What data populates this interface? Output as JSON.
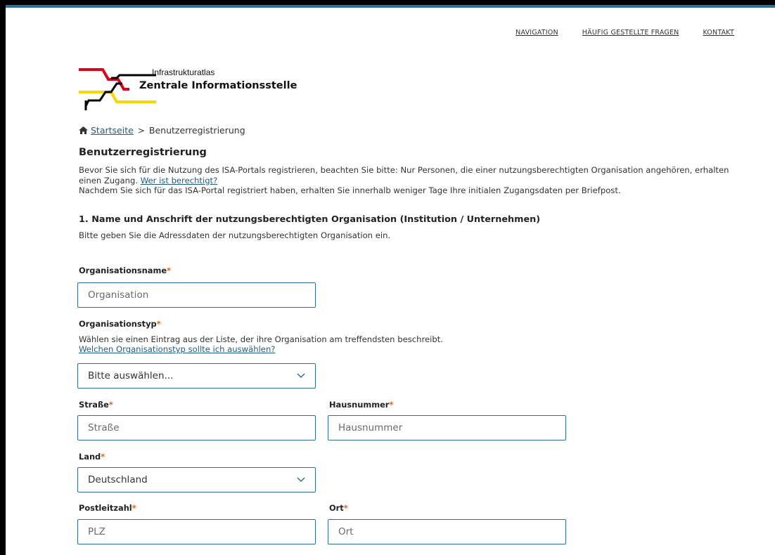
{
  "nav": {
    "items": [
      "NAVIGATION",
      "HÄUFIG GESTELLTE FRAGEN",
      "KONTAKT"
    ]
  },
  "logo": {
    "line1": "Infrastrukturatlas",
    "line2": "Zentrale Informationsstelle",
    "colors": {
      "red": "#e10019",
      "yellow": "#f5d800",
      "black": "#000000"
    }
  },
  "breadcrumb": {
    "home": "Startseite",
    "current": "Benutzerregistrierung"
  },
  "page": {
    "title": "Benutzerregistrierung",
    "intro_part1": "Bevor Sie sich für die Nutzung des ISA-Portals registrieren, beachten Sie bitte: Nur Personen, die einer nutzungsberechtigten Organisation angehören, erhalten einen Zugang.",
    "intro_link": "Wer ist berechtigt?",
    "intro_part2": "Nachdem Sie sich für das ISA-Portal registriert haben, erhalten Sie innerhalb weniger Tage Ihre initialen Zugangsdaten per Briefpost."
  },
  "section1": {
    "title": "1. Name und Anschrift der nutzungsberechtigten Organisation (Institution / Unternehmen)",
    "subtitle": "Bitte geben Sie die Adressdaten der nutzungsberechtigten Organisation ein."
  },
  "form": {
    "required_mark": "*",
    "org_name": {
      "label": "Organisationsname",
      "placeholder": "Organisation"
    },
    "org_type": {
      "label": "Organisationstyp",
      "help": "Wählen sie einen Eintrag aus der Liste, der ihre Organisation am treffendsten beschreibt.",
      "help_link": "Welchen Organisationstyp sollte ich auswählen?",
      "selected": "Bitte auswählen..."
    },
    "street": {
      "label": "Straße",
      "placeholder": "Straße"
    },
    "house_no": {
      "label": "Hausnummer",
      "placeholder": "Hausnummer"
    },
    "country": {
      "label": "Land",
      "selected": "Deutschland"
    },
    "zip": {
      "label": "Postleitzahl",
      "placeholder": "PLZ"
    },
    "city": {
      "label": "Ort",
      "placeholder": "Ort"
    }
  },
  "colors": {
    "accent": "#2f6f95",
    "link": "#1f5c86",
    "required": "#e0601b"
  }
}
